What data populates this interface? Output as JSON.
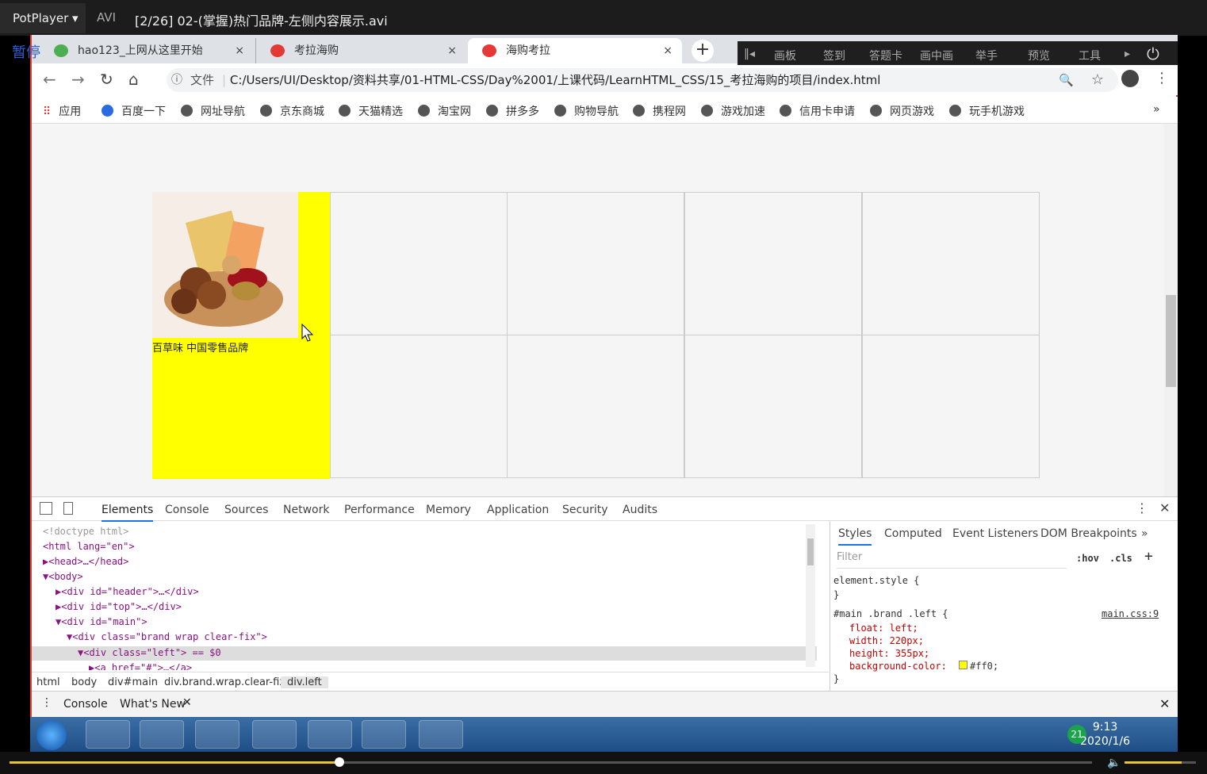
{
  "player": {
    "logo": "PotPlayer",
    "format": "AVI",
    "title": "[2/26] 02-(掌握)热门品牌-左侧内容展示.avi",
    "pause": "暂停",
    "progress": 0.305,
    "volume": 0.8
  },
  "tabs": [
    {
      "label": "hao123_上网从这里开始",
      "close": "×",
      "favicon_color": "#4caf50"
    },
    {
      "label": "考拉海购",
      "close": "×",
      "favicon_color": "#e53935"
    },
    {
      "label": "海购考拉",
      "close": "×",
      "favicon_color": "#e53935"
    }
  ],
  "overlay": {
    "items": [
      "‖◂",
      "画板",
      "签到",
      "答题卡",
      "画中画",
      "举手",
      "预览",
      "工具",
      "▸",
      "⏻"
    ]
  },
  "toolbar": {
    "back": "←",
    "forward": "→",
    "reload": "↻",
    "home": "⌂",
    "info": "ⓘ",
    "file_label": "文件",
    "url": "C:/Users/UI/Desktop/资料共享/01-HTML-CSS/Day%2001/上课代码/LearnHTML_CSS/15_考拉海购的项目/index.html",
    "zoom": "🔍",
    "star": "☆",
    "menu": "⋮"
  },
  "bookmarks": {
    "apps": "应用",
    "items": [
      "百度一下",
      "网址导航",
      "京东商城",
      "天猫精选",
      "淘宝网",
      "拼多多",
      "购物导航",
      "携程网",
      "游戏加速",
      "信用卡申请",
      "网页游戏",
      "玩手机游戏"
    ],
    "more": "»"
  },
  "page": {
    "brand_caption": "百草味 中国零售品牌",
    "left_bg": "#ffff00"
  },
  "devtools": {
    "tabs": [
      "Elements",
      "Console",
      "Sources",
      "Network",
      "Performance",
      "Memory",
      "Application",
      "Security",
      "Audits"
    ],
    "dom": [
      {
        "indent": 0,
        "text": "<!doctype html>",
        "cls": "gray"
      },
      {
        "indent": 0,
        "text": "<html lang=\"en\">",
        "cls": "tag"
      },
      {
        "indent": 1,
        "text": "▶<head>…</head>",
        "cls": "tag"
      },
      {
        "indent": 1,
        "text": "▼<body>",
        "cls": "tag"
      },
      {
        "indent": 2,
        "text": "▶<div id=\"header\">…</div>",
        "cls": "tag"
      },
      {
        "indent": 2,
        "text": "▶<div id=\"top\">…</div>",
        "cls": "tag"
      },
      {
        "indent": 2,
        "text": "▼<div id=\"main\">",
        "cls": "tag"
      },
      {
        "indent": 3,
        "text": "▼<div class=\"brand wrap clear-fix\">",
        "cls": "tag"
      },
      {
        "indent": 4,
        "text": "▼<div class=\"left\"> == $0",
        "cls": "tag"
      },
      {
        "indent": 5,
        "text": "▶<a href=\"#\">…</a>",
        "cls": "tag"
      }
    ],
    "crumbs": [
      "html",
      "body",
      "div#main",
      "div.brand.wrap.clear-fix",
      "div.left"
    ],
    "styles_tabs": [
      "Styles",
      "Computed",
      "Event Listeners",
      "DOM Breakpoints",
      "»"
    ],
    "filter_placeholder": "Filter",
    "hov": ":hov",
    "cls": ".cls",
    "element_style": "element.style {",
    "rule_selector": "#main .brand .left {",
    "rule_source": "main.css:9",
    "props": [
      "float: left;",
      "width: 220px;",
      "height: 355px;",
      "background-color: "
    ],
    "bg_value": "#ff0;",
    "close_brace": "}",
    "drawer_tabs": [
      "Console",
      "What's New"
    ]
  },
  "taskbar": {
    "time": "9:13",
    "date": "2020/1/6",
    "badge": "21"
  }
}
